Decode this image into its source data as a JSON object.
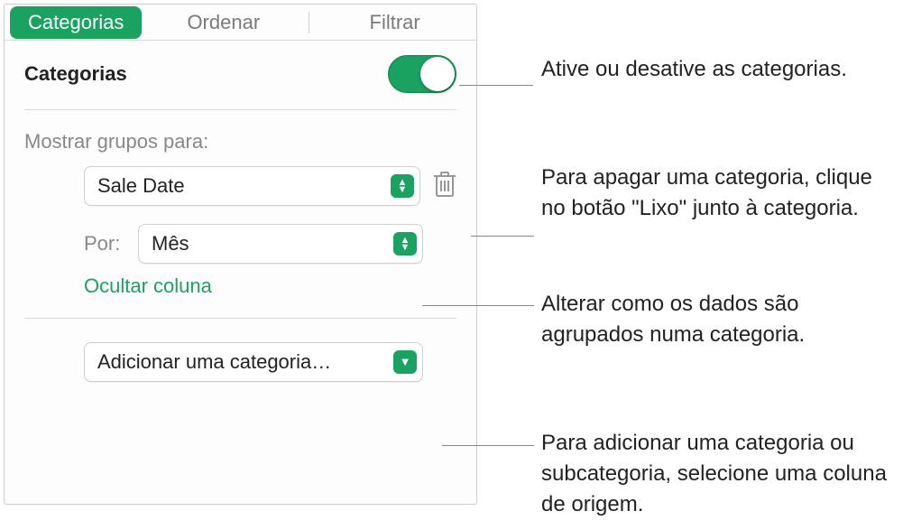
{
  "tabs": {
    "categorias": "Categorias",
    "ordenar": "Ordenar",
    "filtrar": "Filtrar"
  },
  "section": {
    "title": "Categorias"
  },
  "groups": {
    "label": "Mostrar grupos para:",
    "source_value": "Sale Date",
    "by_label": "Por:",
    "by_value": "Mês",
    "hide_column": "Ocultar coluna"
  },
  "add": {
    "label": "Adicionar uma categoria…"
  },
  "callouts": {
    "toggle": "Ative ou desative as categorias.",
    "trash": "Para apagar uma categoria, clique no botão \"Lixo\" junto à categoria.",
    "by": "Alterar como os dados são agrupados numa categoria.",
    "add": "Para adicionar uma categoria ou subcategoria, selecione uma coluna de origem."
  }
}
